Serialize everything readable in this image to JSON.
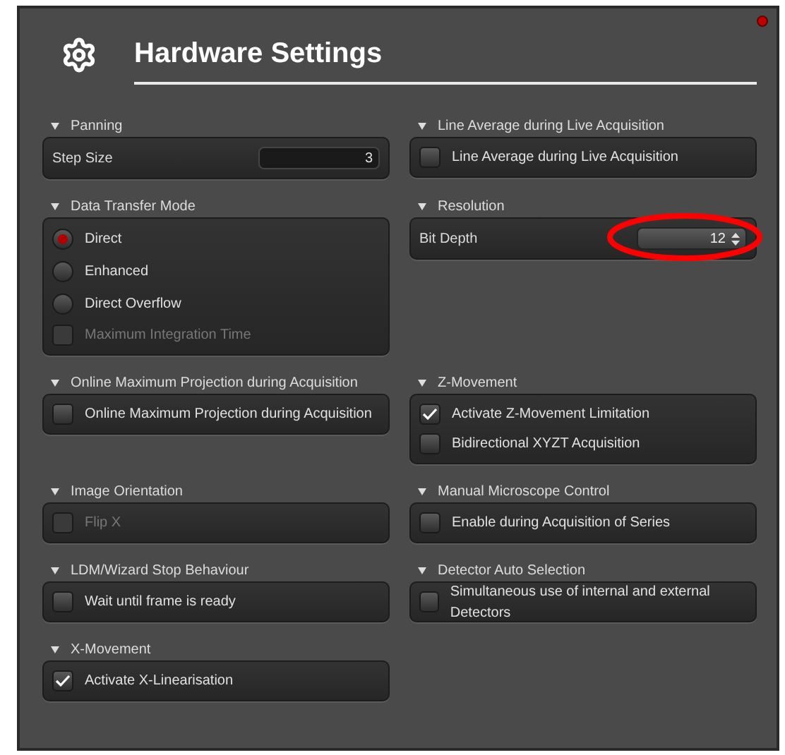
{
  "window": {
    "title": "Hardware Settings",
    "alert": true
  },
  "groups": [
    {
      "title": "Panning",
      "items": [
        {
          "kind": "field",
          "label": "Step Size",
          "value": "3"
        }
      ]
    },
    {
      "title": "Line Average during Live Acquisition",
      "items": [
        {
          "kind": "checkbox",
          "label": "Line Average during Live Acquisition",
          "checked": false,
          "disabled": false
        }
      ]
    },
    {
      "title": "Data Transfer Mode",
      "items": [
        {
          "kind": "radio",
          "label": "Direct",
          "selected": true
        },
        {
          "kind": "radio",
          "label": "Enhanced",
          "selected": false
        },
        {
          "kind": "radio",
          "label": "Direct Overflow",
          "selected": false
        },
        {
          "kind": "checkbox",
          "label": "Maximum Integration Time",
          "checked": false,
          "disabled": true
        }
      ]
    },
    {
      "title": "Resolution",
      "items": [
        {
          "kind": "spin",
          "label": "Bit Depth",
          "value": "12",
          "highlighted": true
        }
      ]
    },
    {
      "title": "Online Maximum Projection during Acquisition",
      "items": [
        {
          "kind": "checkbox",
          "label": "Online Maximum Projection during Acquisition",
          "checked": false,
          "disabled": false
        }
      ]
    },
    {
      "title": "Z-Movement",
      "items": [
        {
          "kind": "checkbox",
          "label": "Activate Z-Movement Limitation",
          "checked": true,
          "disabled": false
        },
        {
          "kind": "checkbox",
          "label": "Bidirectional XYZT Acquisition",
          "checked": false,
          "disabled": false
        }
      ]
    },
    {
      "title": "Image Orientation",
      "items": [
        {
          "kind": "checkbox",
          "label": "Flip X",
          "checked": false,
          "disabled": true
        }
      ]
    },
    {
      "title": "Manual Microscope Control",
      "items": [
        {
          "kind": "checkbox",
          "label": "Enable during Acquisition of Series",
          "checked": false,
          "disabled": false
        }
      ]
    },
    {
      "title": "LDM/Wizard Stop Behaviour",
      "items": [
        {
          "kind": "checkbox",
          "label": "Wait until frame is ready",
          "checked": false,
          "disabled": false
        }
      ]
    },
    {
      "title": "Detector Auto Selection",
      "items": [
        {
          "kind": "checkbox",
          "label": "Simultaneous use of internal and external Detectors",
          "checked": false,
          "disabled": false
        }
      ]
    },
    {
      "title": "X-Movement",
      "items": [
        {
          "kind": "checkbox",
          "label": "Activate X-Linearisation",
          "checked": true,
          "disabled": false
        }
      ]
    }
  ]
}
